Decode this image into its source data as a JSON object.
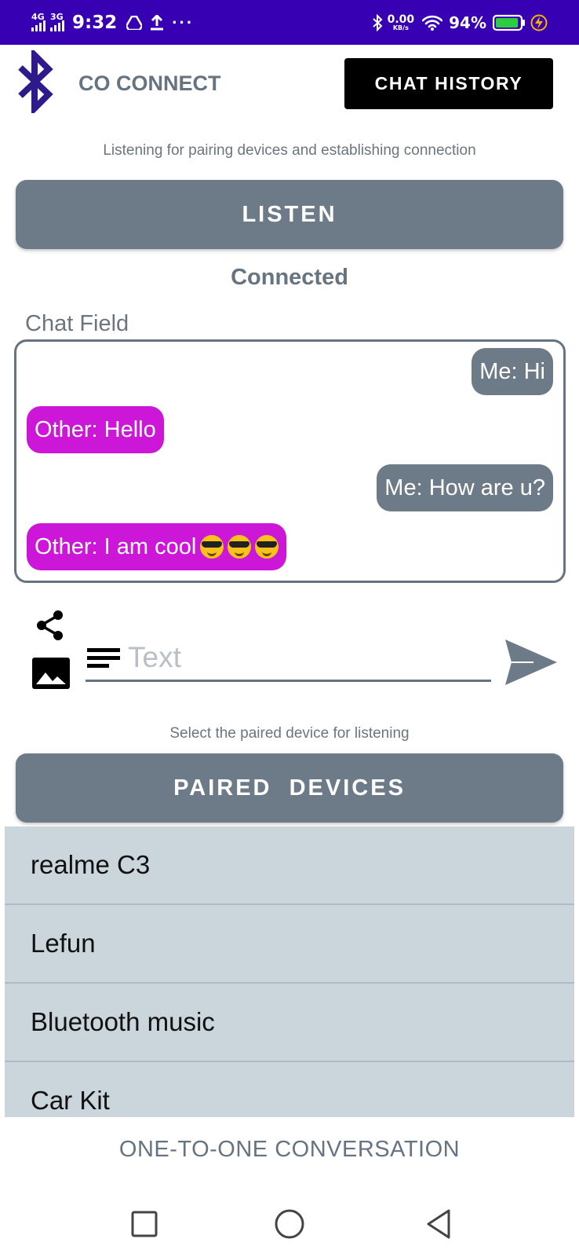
{
  "status_bar": {
    "network_1": "4G",
    "network_2": "3G",
    "time": "9:32",
    "more": "···",
    "speed_value": "0.00",
    "speed_unit": "KB/s",
    "battery": "94%",
    "battery_level": 0.94
  },
  "header": {
    "app_title": "CO CONNECT",
    "history_button": "CHAT HISTORY"
  },
  "listen": {
    "hint": "Listening for pairing devices and establishing connection",
    "button": "LISTEN",
    "status": "Connected"
  },
  "chat": {
    "label": "Chat Field",
    "messages": [
      {
        "sender": "me",
        "text": "Me:  Hi"
      },
      {
        "sender": "other",
        "text": "Other:  Hello"
      },
      {
        "sender": "me",
        "text": "Me:  How are u?"
      },
      {
        "sender": "other",
        "text": "Other:  I am cool",
        "emoji_count": 3
      }
    ]
  },
  "composer": {
    "placeholder": "Text",
    "value": ""
  },
  "paired": {
    "hint": "Select the paired device for listening",
    "button": "PAIRED  DEVICES",
    "devices": [
      "realme C3",
      "Lefun",
      "Bluetooth music",
      "Car Kit"
    ]
  },
  "footer": {
    "label": "ONE-TO-ONE CONVERSATION"
  },
  "colors": {
    "status_bar": "#3700b3",
    "accent_gray": "#6d7a88",
    "other_bubble": "#cc17d8",
    "list_bg": "#cad5dc"
  }
}
